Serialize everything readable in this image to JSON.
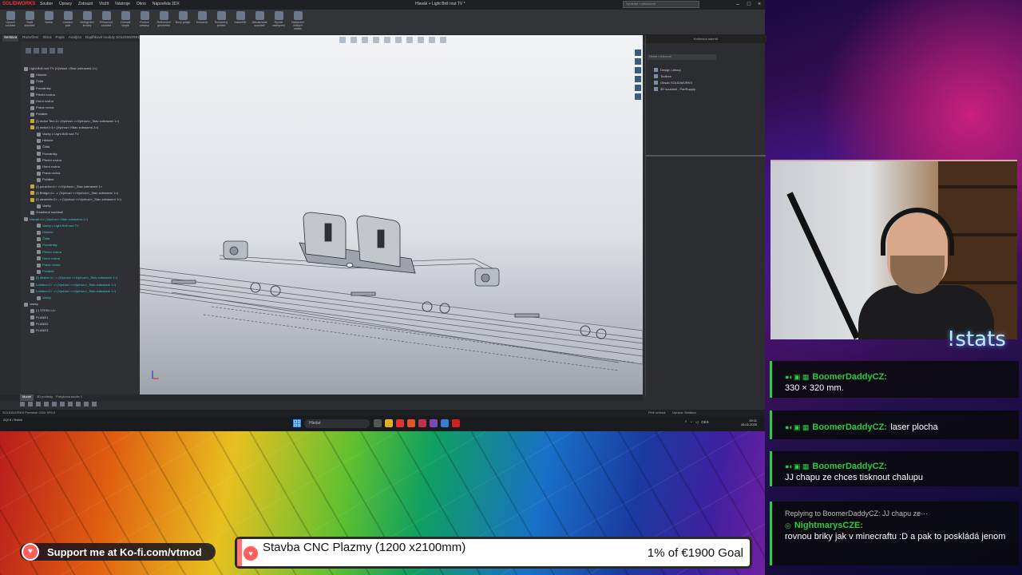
{
  "solidworks": {
    "logo": "SOLIDWORKS",
    "menu": [
      "Soubor",
      "Úpravy",
      "Zobrazit",
      "Vložit",
      "Nástroje",
      "Okno",
      "Nápověda 3DX"
    ],
    "doc_title": "Hlavák + Light Brill rout TV *",
    "search_placeholder": "Vyhledat v příkazech",
    "ribbon_buttons": [
      "Upravit součást",
      "Vložit součásti",
      "Vazba",
      "Lineární pole",
      "Inteligentní šrouby",
      "Přesunout součást",
      "Zobrazit skryté",
      "Funkce sestavy",
      "Referenční geometrie",
      "Nový pohyb",
      "Kusovník",
      "Rozložený pohled",
      "Instant3D",
      "Aktualizovat součásti",
      "Rychlé zachycení",
      "Nastavení velkých sestav"
    ],
    "command_tabs": [
      "Sestava",
      "Rozvržení",
      "Skica",
      "Popis",
      "Analýza",
      "Doplňkové moduly SOLIDWORKS",
      "MBD",
      "SOLIDWORKS CAM",
      "SOLIDWORKS Visualize"
    ],
    "active_command_tab": "Sestava",
    "tree_items": [
      {
        "label": "Light Brill rout TV (Výchozí <Stav zobrazení-1>)",
        "indent": 0,
        "style": "normal"
      },
      {
        "label": "Historie",
        "indent": 1,
        "style": "normal"
      },
      {
        "label": "Čidla",
        "indent": 1,
        "style": "normal"
      },
      {
        "label": "Poznámky",
        "indent": 1,
        "style": "normal"
      },
      {
        "label": "Přední rovina",
        "indent": 1,
        "style": "normal"
      },
      {
        "label": "Horní rovina",
        "indent": 1,
        "style": "normal"
      },
      {
        "label": "Pravá rovina",
        "indent": 1,
        "style": "normal"
      },
      {
        "label": "Počátek",
        "indent": 1,
        "style": "normal"
      },
      {
        "label": "(f) motor Tex<1> (Výchozí <<Výchozí>_Stav zobrazení 1>)",
        "indent": 1,
        "style": "y"
      },
      {
        "label": "(f) motor1<1> (Výchozí <Stav zobrazení-1>)",
        "indent": 1,
        "style": "y"
      },
      {
        "label": "Vazby v Light Brill rout TV",
        "indent": 2,
        "style": "normal"
      },
      {
        "label": "Historie",
        "indent": 2,
        "style": "normal"
      },
      {
        "label": "Čidla",
        "indent": 2,
        "style": "normal"
      },
      {
        "label": "Poznámky",
        "indent": 2,
        "style": "normal"
      },
      {
        "label": "Přední rovina",
        "indent": 2,
        "style": "normal"
      },
      {
        "label": "Horní rovina",
        "indent": 2,
        "style": "normal"
      },
      {
        "label": "Pravá rovina",
        "indent": 2,
        "style": "normal"
      },
      {
        "label": "Počátek",
        "indent": 2,
        "style": "normal"
      },
      {
        "label": "(f) pouzdro<1> <<Výchozí>_Stav zobrazení 1>",
        "indent": 1,
        "style": "y"
      },
      {
        "label": "(f) Bridge<1> -> (Výchozí <<Výchozí>_Stav zobrazení 1>)",
        "indent": 1,
        "style": "y"
      },
      {
        "label": "(f) rámeček<1> -> (Výchozí <<Výchozí>_Stav zobrazení 1>)",
        "indent": 1,
        "style": "y"
      },
      {
        "label": "Vazby",
        "indent": 2,
        "style": "normal"
      },
      {
        "label": "Zrcadlené součásti",
        "indent": 1,
        "style": "normal"
      },
      {
        "label": "Hlavák<1> (Výchozí <Stav zobrazení-1>)",
        "indent": 0,
        "style": "hl"
      },
      {
        "label": "Vazby v Light Brill rout TV",
        "indent": 2,
        "style": "hl"
      },
      {
        "label": "Historie",
        "indent": 2,
        "style": "hl"
      },
      {
        "label": "Čidla",
        "indent": 2,
        "style": "hl"
      },
      {
        "label": "Poznámky",
        "indent": 2,
        "style": "hl"
      },
      {
        "label": "Přední rovina",
        "indent": 2,
        "style": "hl"
      },
      {
        "label": "Horní rovina",
        "indent": 2,
        "style": "hl"
      },
      {
        "label": "Pravá rovina",
        "indent": 2,
        "style": "hl"
      },
      {
        "label": "Počátek",
        "indent": 2,
        "style": "hl"
      },
      {
        "label": "(f) deska<1> -> (Výchozí <<Výchozí>_Stav zobrazení 1>)",
        "indent": 1,
        "style": "hl"
      },
      {
        "label": "Ložisko<1> -> (Výchozí <<Výchozí>_Stav zobrazení 1>)",
        "indent": 1,
        "style": "hl"
      },
      {
        "label": "Ložisko<2> -> (Výchozí <<Výchozí>_Stav zobrazení 1>)",
        "indent": 1,
        "style": "hl"
      },
      {
        "label": "Vazby",
        "indent": 2,
        "style": "hl"
      },
      {
        "label": "Vazby",
        "indent": 0,
        "style": "normal"
      },
      {
        "label": "(-) STEEL<1>",
        "indent": 1,
        "style": "normal"
      },
      {
        "label": "PLANE1",
        "indent": 1,
        "style": "normal"
      },
      {
        "label": "PLANE2",
        "indent": 1,
        "style": "normal"
      },
      {
        "label": "PLANE3",
        "indent": 1,
        "style": "normal"
      }
    ],
    "taskpane": {
      "header": "Knihovna návrhů",
      "search": "Hledat v knihovně",
      "items": [
        "Design Library",
        "Toolbox",
        "Obsah SOLIDWORKS",
        "3D součásti - PartSupply"
      ]
    },
    "bottom_tabs": [
      "Model",
      "3D pohledy",
      "Pohybová studie 1"
    ],
    "active_bottom_tab": "Model",
    "status_left": "SOLIDWORKS Premium 2024 SP0.0",
    "status_right1": "Plně určená",
    "status_right2": "Úprava: Sestava",
    "taskbar": {
      "weather": "AQI 6 / Nízká",
      "search": "Hledat",
      "tray": "CES",
      "time": "20:11",
      "date": "28.02.2025"
    }
  },
  "overlay": {
    "stats_command": "!stats",
    "chat": [
      {
        "user": "BoomerDaddyCZ:",
        "message": "330 × 320 mm.",
        "reply": ""
      },
      {
        "user": "BoomerDaddyCZ:",
        "message": "laser plocha",
        "reply": ""
      },
      {
        "user": "BoomerDaddyCZ:",
        "message": "JJ chapu ze chces tisknout chalupu",
        "reply": ""
      },
      {
        "user": "NightmarysCZE:",
        "message": "rovnou briky jak v minecraftu :D a pak to poskládá jenom",
        "reply": "Replying to BoomerDaddyCZ: JJ chapu ze···"
      }
    ],
    "kofi_text": "Support me at Ko-fi.com/vtmod",
    "goal_title": "Stavba CNC Plazmy (1200 x2100mm)",
    "goal_amount": "1% of €1900 Goal",
    "goal_progress": 0.01
  },
  "colors": {
    "chat_accent": "#2ecc40",
    "kofi_red": "#ff5e5b",
    "tree_highlight": "#3ec7e8"
  }
}
